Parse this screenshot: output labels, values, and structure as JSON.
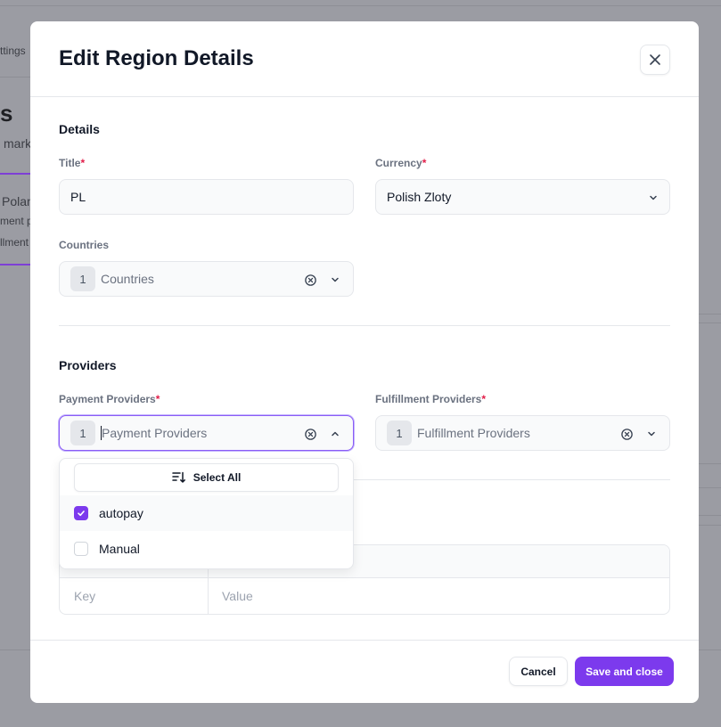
{
  "background": {
    "nav_fragment": "ttings",
    "heading_fragment": "s",
    "subtitle_fragment": "mark",
    "region_fragment": "Polan",
    "payment_fragment": "ment p",
    "fulfillment_fragment": "llment"
  },
  "modal": {
    "title": "Edit Region Details",
    "details": {
      "section_title": "Details",
      "title_label": "Title",
      "title_value": "PL",
      "currency_label": "Currency",
      "currency_value": "Polish Zloty",
      "countries_label": "Countries",
      "countries_count": "1",
      "countries_placeholder": "Countries"
    },
    "providers": {
      "section_title": "Providers",
      "payment_label": "Payment Providers",
      "payment_count": "1",
      "payment_placeholder": "Payment Providers",
      "fulfillment_label": "Fulfillment Providers",
      "fulfillment_count": "1",
      "fulfillment_placeholder": "Fulfillment Providers",
      "required_mark": "*"
    },
    "dropdown": {
      "select_all_label": "Select All",
      "options": [
        {
          "label": "autopay",
          "checked": true
        },
        {
          "label": "Manual",
          "checked": false
        }
      ]
    },
    "metadata": {
      "key_placeholder": "Key",
      "value_placeholder": "Value"
    },
    "footer": {
      "cancel_label": "Cancel",
      "save_label": "Save and close"
    }
  },
  "colors": {
    "accent": "#7c3aed",
    "required": "#e11d48",
    "overlay": "#9b9ca3"
  }
}
